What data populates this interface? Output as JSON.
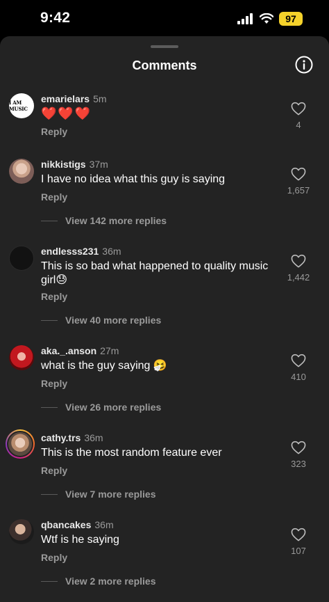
{
  "status_bar": {
    "time": "9:42",
    "battery": "97"
  },
  "sheet": {
    "title": "Comments"
  },
  "comments": [
    {
      "username": "emarielars",
      "time": "5m",
      "text": "❤️❤️❤️",
      "reply_label": "Reply",
      "likes": "4",
      "view_replies": "",
      "avatar_text": "I AM MUSIC"
    },
    {
      "username": "nikkistigs",
      "time": "37m",
      "text": "I have no idea what this guy is saying",
      "reply_label": "Reply",
      "likes": "1,657",
      "view_replies": "View 142 more replies"
    },
    {
      "username": "endlesss231",
      "time": "36m",
      "text": "This is so bad what happened to quality music girl😓",
      "reply_label": "Reply",
      "likes": "1,442",
      "view_replies": "View 40 more replies"
    },
    {
      "username": "aka._.anson",
      "time": "27m",
      "text": "what is the guy saying 🤧",
      "reply_label": "Reply",
      "likes": "410",
      "view_replies": "View 26 more replies"
    },
    {
      "username": "cathy.trs",
      "time": "36m",
      "text": "This is the most random feature ever",
      "reply_label": "Reply",
      "likes": "323",
      "view_replies": "View 7 more replies"
    },
    {
      "username": "qbancakes",
      "time": "36m",
      "text": "Wtf is he saying",
      "reply_label": "Reply",
      "likes": "107",
      "view_replies": "View 2 more replies"
    }
  ],
  "icons": {
    "signal": "cellular-signal-icon",
    "wifi": "wifi-icon",
    "info": "info-icon",
    "like": "heart-outline-icon"
  }
}
